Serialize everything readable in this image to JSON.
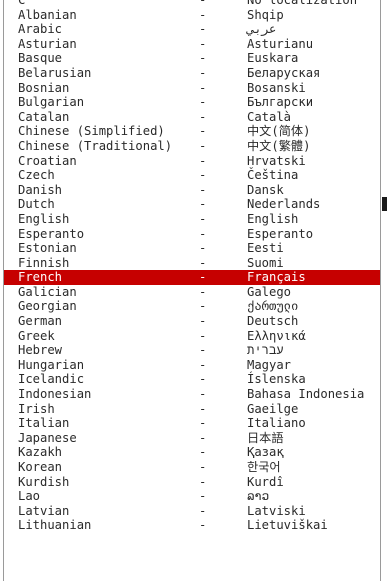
{
  "languages": [
    {
      "name": "C",
      "native": "No localization"
    },
    {
      "name": "Albanian",
      "native": "Shqip"
    },
    {
      "name": "Arabic",
      "native": "عربي"
    },
    {
      "name": "Asturian",
      "native": "Asturianu"
    },
    {
      "name": "Basque",
      "native": "Euskara"
    },
    {
      "name": "Belarusian",
      "native": "Беларуская"
    },
    {
      "name": "Bosnian",
      "native": "Bosanski"
    },
    {
      "name": "Bulgarian",
      "native": "Български"
    },
    {
      "name": "Catalan",
      "native": "Català"
    },
    {
      "name": "Chinese (Simplified)",
      "native": "中文(简体)"
    },
    {
      "name": "Chinese (Traditional)",
      "native": "中文(繁體)"
    },
    {
      "name": "Croatian",
      "native": "Hrvatski"
    },
    {
      "name": "Czech",
      "native": "Čeština"
    },
    {
      "name": "Danish",
      "native": "Dansk"
    },
    {
      "name": "Dutch",
      "native": "Nederlands"
    },
    {
      "name": "English",
      "native": "English"
    },
    {
      "name": "Esperanto",
      "native": "Esperanto"
    },
    {
      "name": "Estonian",
      "native": "Eesti"
    },
    {
      "name": "Finnish",
      "native": "Suomi"
    },
    {
      "name": "French",
      "native": "Français",
      "selected": true
    },
    {
      "name": "Galician",
      "native": "Galego"
    },
    {
      "name": "Georgian",
      "native": "ქართული"
    },
    {
      "name": "German",
      "native": "Deutsch"
    },
    {
      "name": "Greek",
      "native": "Ελληνικά"
    },
    {
      "name": "Hebrew",
      "native": "עברית"
    },
    {
      "name": "Hungarian",
      "native": "Magyar"
    },
    {
      "name": "Icelandic",
      "native": "Íslenska"
    },
    {
      "name": "Indonesian",
      "native": "Bahasa Indonesia"
    },
    {
      "name": "Irish",
      "native": "Gaeilge"
    },
    {
      "name": "Italian",
      "native": "Italiano"
    },
    {
      "name": "Japanese",
      "native": "日本語"
    },
    {
      "name": "Kazakh",
      "native": "Қазақ"
    },
    {
      "name": "Korean",
      "native": "한국어"
    },
    {
      "name": "Kurdish",
      "native": "Kurdî"
    },
    {
      "name": "Lao",
      "native": "ລາວ"
    },
    {
      "name": "Latvian",
      "native": "Latviski"
    },
    {
      "name": "Lithuanian",
      "native": "Lietuviškai"
    }
  ],
  "separator": "-",
  "colors": {
    "selected_bg": "#c60000",
    "selected_fg": "#ffffff",
    "text": "#2a2a2a"
  }
}
